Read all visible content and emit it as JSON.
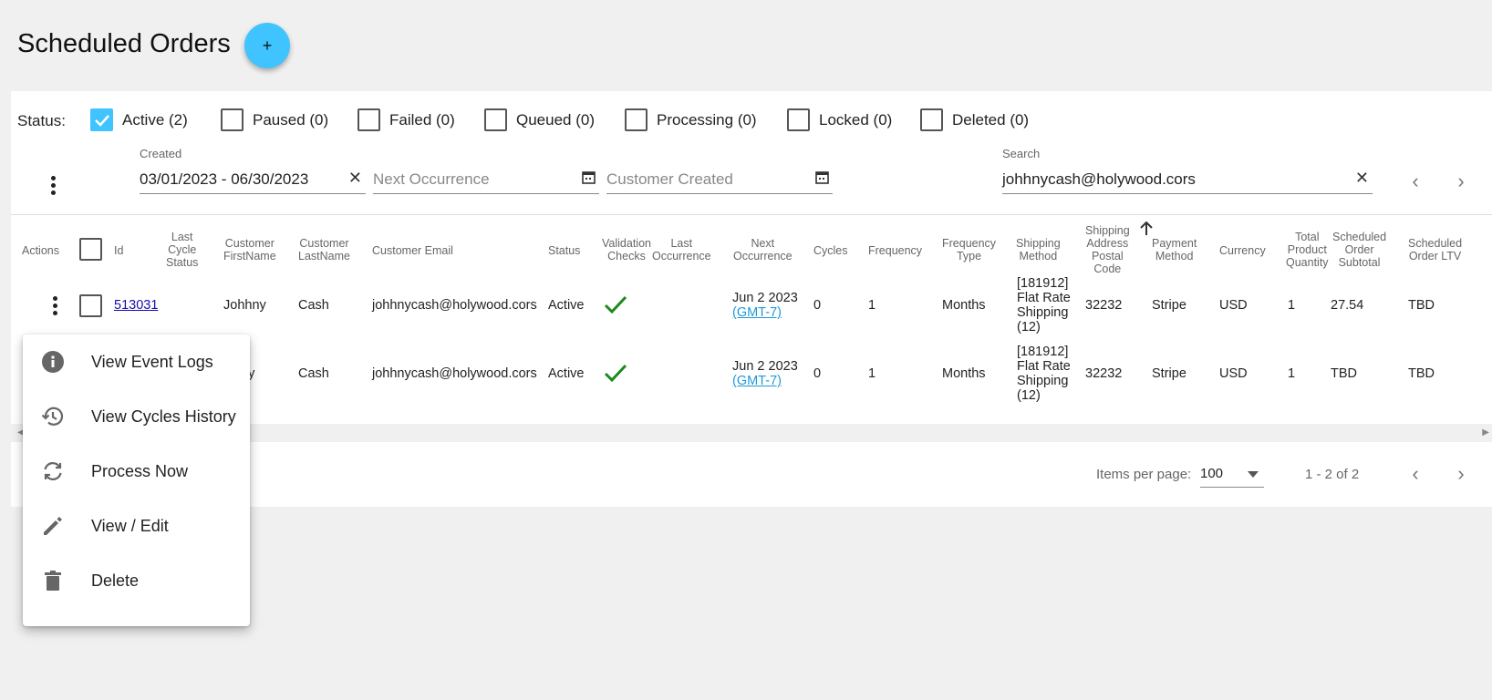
{
  "page": {
    "title": "Scheduled Orders",
    "add_button": "+"
  },
  "filters": {
    "status_label": "Status:",
    "statuses": [
      {
        "label": "Active (2)",
        "checked": true
      },
      {
        "label": "Paused (0)",
        "checked": false
      },
      {
        "label": "Failed (0)",
        "checked": false
      },
      {
        "label": "Queued (0)",
        "checked": false
      },
      {
        "label": "Processing (0)",
        "checked": false
      },
      {
        "label": "Locked (0)",
        "checked": false
      },
      {
        "label": "Deleted (0)",
        "checked": false
      }
    ],
    "created": {
      "label": "Created",
      "value": "03/01/2023 - 06/30/2023",
      "clear_icon": "close-icon"
    },
    "next_occurrence": {
      "placeholder": "Next Occurrence",
      "icon": "calendar-icon"
    },
    "customer_created": {
      "placeholder": "Customer Created",
      "icon": "calendar-icon"
    },
    "search": {
      "label": "Search",
      "value": "johhnycash@holywood.cors",
      "clear_icon": "close-icon"
    }
  },
  "table": {
    "headers": {
      "actions": "Actions",
      "id": "Id",
      "last_cycle_status": [
        "Last",
        "Cycle",
        "Status"
      ],
      "customer_firstname": [
        "Customer",
        "FirstName"
      ],
      "customer_lastname": [
        "Customer",
        "LastName"
      ],
      "customer_email": "Customer Email",
      "status": "Status",
      "validation_checks": [
        "Validation",
        "Checks"
      ],
      "last_occurrence": [
        "Last",
        "Occurrence"
      ],
      "next_occurrence": [
        "Next",
        "Occurrence"
      ],
      "cycles": "Cycles",
      "frequency": "Frequency",
      "frequency_type": [
        "Frequency",
        "Type"
      ],
      "shipping_method": [
        "Shipping",
        "Method"
      ],
      "shipping_postal": [
        "Shipping",
        "Address",
        "Postal",
        "Code"
      ],
      "payment_method": [
        "Payment",
        "Method"
      ],
      "currency": "Currency",
      "total_qty": [
        "Total",
        "Product",
        "Quantity"
      ],
      "subtotal": [
        "Scheduled",
        "Order",
        "Subtotal"
      ],
      "ltv": [
        "Scheduled",
        "Order LTV"
      ]
    },
    "sort_icon": "arrow-up-icon",
    "rows": [
      {
        "id": "513031",
        "firstname": "Johhny",
        "lastname": "Cash",
        "email": "johhnycash@holywood.cors",
        "status": "Active",
        "next_date": "Jun 2 2023",
        "next_tz": "(GMT-7)",
        "cycles": "0",
        "frequency": "1",
        "frequency_type": "Months",
        "shipping": [
          "[181912]",
          "Flat Rate",
          "Shipping",
          "(12)"
        ],
        "postal": "32232",
        "payment": "Stripe",
        "currency": "USD",
        "qty": "1",
        "subtotal": "27.54",
        "ltv": "TBD"
      },
      {
        "id": "",
        "firstname_partial": "nny",
        "lastname": "Cash",
        "email": "johhnycash@holywood.cors",
        "status": "Active",
        "next_date": "Jun 2 2023",
        "next_tz": "(GMT-7)",
        "cycles": "0",
        "frequency": "1",
        "frequency_type": "Months",
        "shipping": [
          "[181912]",
          "Flat Rate",
          "Shipping",
          "(12)"
        ],
        "postal": "32232",
        "payment": "Stripe",
        "currency": "USD",
        "qty": "1",
        "subtotal": "TBD",
        "ltv": "TBD"
      }
    ]
  },
  "paginator": {
    "items_per_page_label": "Items per page:",
    "items_per_page": "100",
    "range": "1 - 2 of 2"
  },
  "context_menu": {
    "items": [
      {
        "label": "View Event Logs",
        "icon": "info-icon"
      },
      {
        "label": "View Cycles History",
        "icon": "history-icon"
      },
      {
        "label": "Process Now",
        "icon": "sync-icon"
      },
      {
        "label": "View / Edit",
        "icon": "pencil-icon"
      },
      {
        "label": "Delete",
        "icon": "trash-icon"
      }
    ]
  },
  "colors": {
    "accent": "#40c4ff",
    "check_green": "#1b8a1b",
    "link": "#1a0dab",
    "tz_link": "#1e9ad6"
  }
}
